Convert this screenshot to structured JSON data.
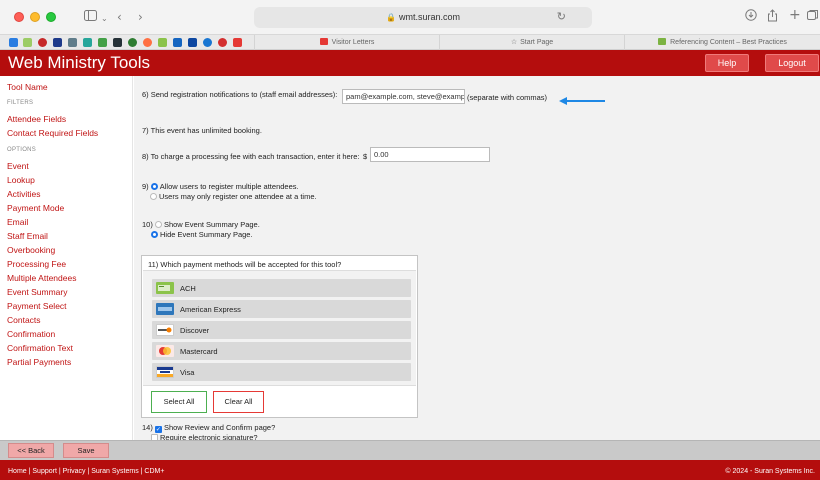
{
  "browser": {
    "url": "wmt.suran.com",
    "tabs": [
      {
        "label": "Visitor Letters"
      },
      {
        "label": "Start Page"
      },
      {
        "label": "Referencing Content – Best Practices"
      }
    ],
    "icons": {
      "sidebar": "sidebar-icon",
      "back": "chevron-left-icon",
      "forward": "chevron-right-icon",
      "reload": "reload-icon",
      "download": "download-icon",
      "share": "share-icon",
      "new_tab": "plus-icon",
      "tabs_overview": "tabs-icon",
      "star": "star-icon",
      "lock": "lock-icon"
    }
  },
  "app": {
    "title": "Web Ministry Tools",
    "help": "Help",
    "logout": "Logout",
    "accent": "#b40d0d"
  },
  "sidebar": {
    "tool_name": "Tool Name",
    "filters_head": "FILTERS",
    "filters": [
      "Attendee Fields",
      "Contact Required Fields"
    ],
    "options_head": "OPTIONS",
    "options": [
      "Event",
      "Lookup",
      "Activities",
      "Payment Mode",
      "Email",
      "Staff Email",
      "Overbooking",
      "Processing Fee",
      "Multiple Attendees",
      "Event Summary",
      "Payment Select",
      "Contacts",
      "Confirmation",
      "Confirmation Text",
      "Partial Payments"
    ]
  },
  "main": {
    "q6_label": "6) Send registration notifications to (staff email addresses):",
    "q6_value": "pam@example.com, steve@example.com",
    "q6_hint": "(separate with commas)",
    "q7": "7) This event has unlimited booking.",
    "q8_label": "8) To charge a processing fee with each transaction, enter it here:",
    "q8_currency": "$",
    "q8_value": "0.00",
    "q9_num": "9)",
    "q9_opt1": "Allow users to register multiple attendees.",
    "q9_opt2": "Users may only register one attendee at a time.",
    "q10_num": "10)",
    "q10_opt1": "Show Event Summary Page.",
    "q10_opt2": "Hide Event Summary Page.",
    "q11": "11) Which payment methods will be accepted for this tool?",
    "payments": [
      {
        "label": "ACH",
        "icon": "ach-icon"
      },
      {
        "label": "American Express",
        "icon": "amex-icon"
      },
      {
        "label": "Discover",
        "icon": "discover-icon"
      },
      {
        "label": "Mastercard",
        "icon": "mastercard-icon"
      },
      {
        "label": "Visa",
        "icon": "visa-icon"
      }
    ],
    "select_all": "Select All",
    "clear_all": "Clear All",
    "q14_num": "14)",
    "q14_opt1": "Show Review and Confirm page?",
    "q14_opt2": "Require electronic signature?"
  },
  "actions": {
    "back": "<< Back",
    "save": "Save"
  },
  "footer": {
    "links": "Home | Support | Privacy | Suran Systems | CDM+",
    "copyright": "© 2024 - Suran Systems Inc."
  }
}
